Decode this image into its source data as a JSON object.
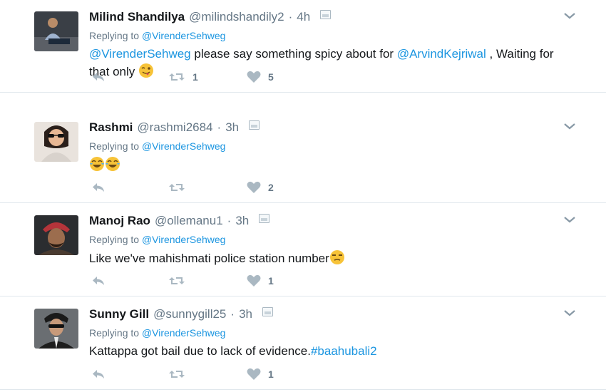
{
  "tweets": [
    {
      "name": "Milind Shandilya",
      "handle": "@milindshandily2",
      "dot": "·",
      "time": "4h",
      "replying_label": "Replying to",
      "replying_to": "@VirenderSehweg",
      "text": {
        "mention1": "@VirenderSehweg",
        "mid": " please say something spicy about for ",
        "mention2": "@ArvindKejriwal",
        "tail": " , Waiting for that only "
      },
      "retweets": "1",
      "likes": "5"
    },
    {
      "name": "Rashmi",
      "handle": "@rashmi2684",
      "dot": "·",
      "time": "3h",
      "replying_label": "Replying to",
      "replying_to": "@VirenderSehweg",
      "retweets": "",
      "likes": "2"
    },
    {
      "name": "Manoj Rao",
      "handle": "@ollemanu1",
      "dot": "·",
      "time": "3h",
      "replying_label": "Replying to",
      "replying_to": "@VirenderSehweg",
      "text": {
        "plain": "Like we've mahishmati police station number"
      },
      "retweets": "",
      "likes": "1"
    },
    {
      "name": "Sunny Gill",
      "handle": "@sunnygill25",
      "dot": "·",
      "time": "3h",
      "replying_label": "Replying to",
      "replying_to": "@VirenderSehweg",
      "text": {
        "plain": "Kattappa got bail due to lack of evidence.",
        "hashtag": "#baahubali2"
      },
      "retweets": "",
      "likes": "1"
    }
  ],
  "icons": {
    "reply": "reply-icon",
    "retweet": "retweet-icon",
    "like": "heart-icon",
    "caret": "chevron-down-icon",
    "media": "media-icon"
  },
  "colors": {
    "link": "#1b95e0",
    "secondary": "#657786",
    "icon": "#aab8c2",
    "divider": "#e1e8ed"
  }
}
